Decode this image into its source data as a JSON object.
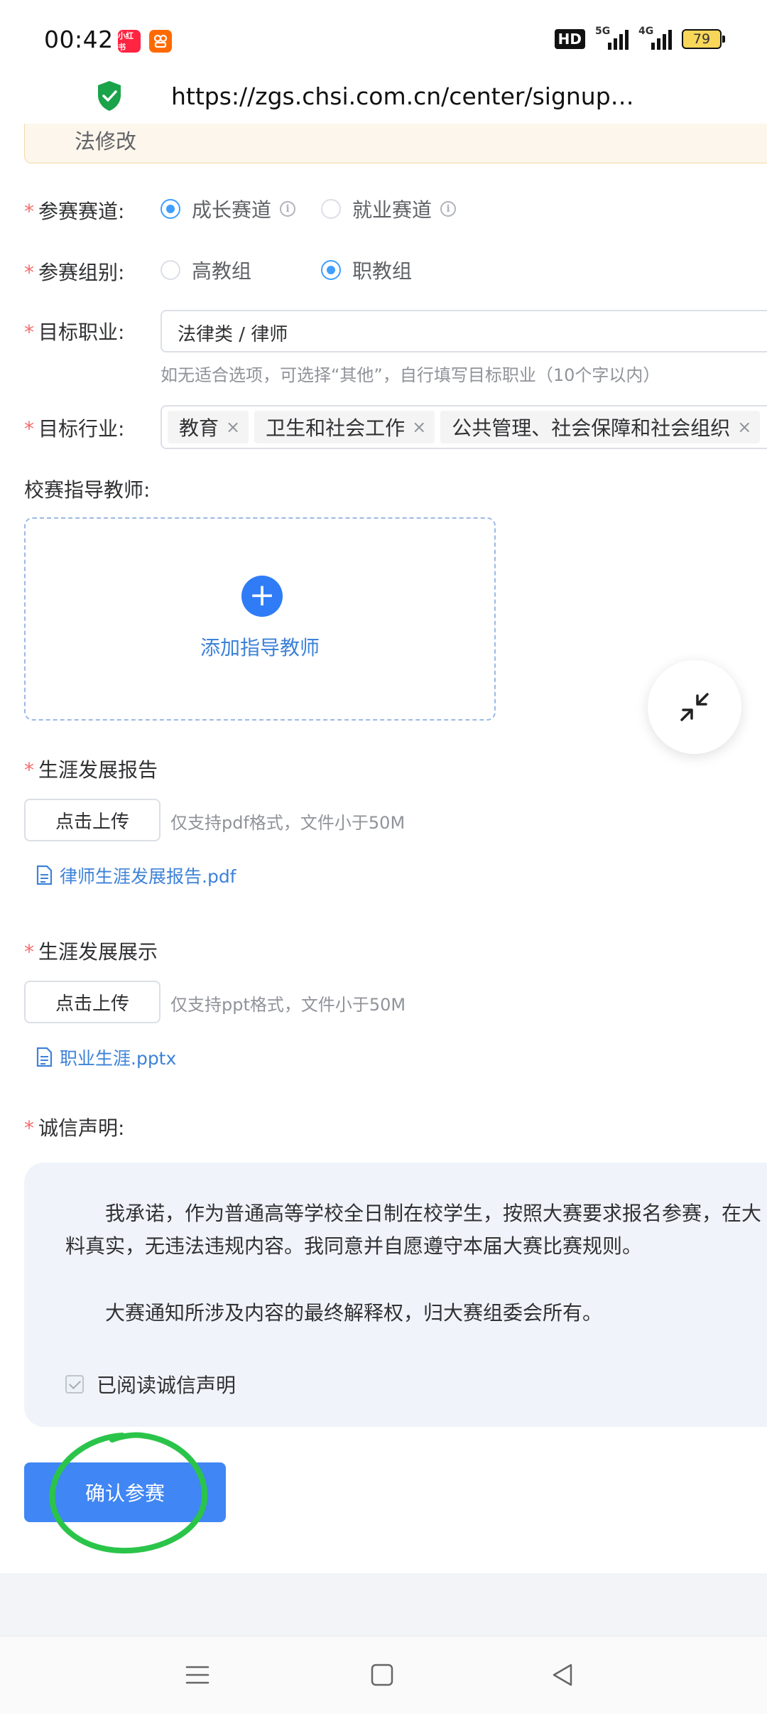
{
  "status_bar": {
    "time": "00:42",
    "apps": [
      {
        "name": "xiaohongshu-app-icon",
        "label": "小红书",
        "color": "#ff2442"
      },
      {
        "name": "taobao-app-icon",
        "label": "",
        "color": "#ff6a00"
      }
    ],
    "network_badge": "HD",
    "signal_1": "5G",
    "signal_2": "4G",
    "battery": "79"
  },
  "url_bar": {
    "url": "https://zgs.chsi.com.cn/center/signup…",
    "secure_icon": "shield-check-icon",
    "secure_color": "#1aa34a"
  },
  "notice": {
    "text": "法修改"
  },
  "form": {
    "track": {
      "label": "参赛赛道:",
      "options": [
        "成长赛道",
        "就业赛道"
      ],
      "selected": "成长赛道"
    },
    "group": {
      "label": "参赛组别:",
      "options": [
        "高教组",
        "职教组"
      ],
      "selected": "职教组"
    },
    "career": {
      "label": "目标职业:",
      "value": "法律类 / 律师",
      "hint": "如无适合选项，可选择“其他”，自行填写目标职业（10个字以内）"
    },
    "industry": {
      "label": "目标行业:",
      "tags": [
        "教育",
        "卫生和社会工作",
        "公共管理、社会保障和社会组织"
      ]
    },
    "advisor": {
      "label": "校赛指导教师:",
      "add_label": "添加指导教师"
    },
    "report": {
      "label": "生涯发展报告",
      "upload_label": "点击上传",
      "tip": "仅支持pdf格式，文件小于50M",
      "file": "律师生涯发展报告.pdf"
    },
    "showcase": {
      "label": "生涯发展展示",
      "upload_label": "点击上传",
      "tip": "仅支持ppt格式，文件小于50M",
      "file": "职业生涯.pptx"
    },
    "declaration": {
      "label": "诚信声明:",
      "para1_line1": "我承诺，作为普通高等学校全日制在校学生，按照大赛要求报名参赛，在大",
      "para1_line2": "料真实，无违法违规内容。我同意并自愿遵守本届大赛比赛规则。",
      "para2": "大赛通知所涉及内容的最终解释权，归大赛组委会所有。",
      "checkbox_label": "已阅读诚信声明",
      "checked": true
    },
    "submit_label": "确认参赛"
  },
  "colors": {
    "primary": "#409eff",
    "button": "#4086f4",
    "required": "#f56c6c",
    "annotation": "#2bc44a"
  }
}
